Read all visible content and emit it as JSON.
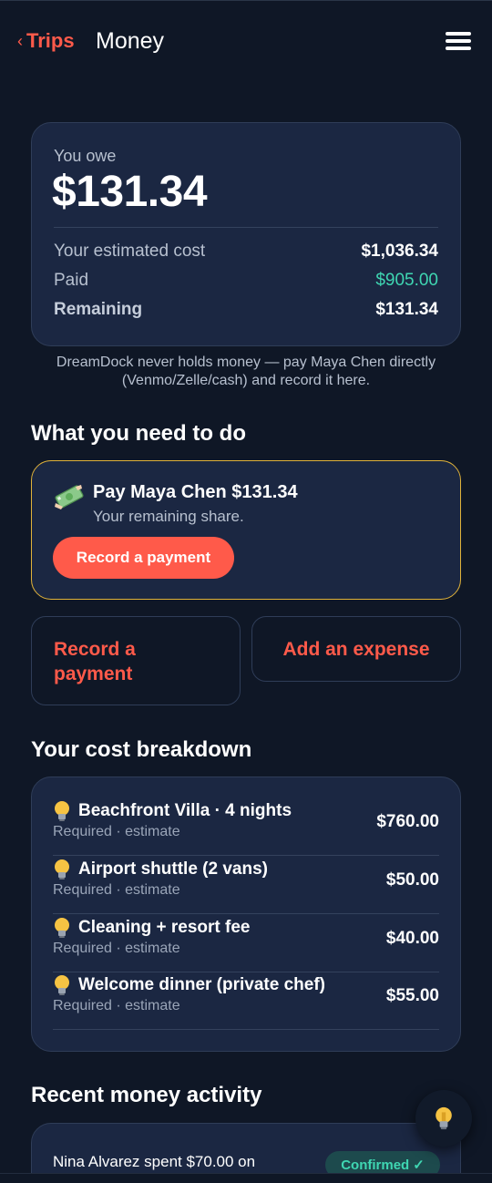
{
  "header": {
    "back_label": "Trips",
    "back_chevron": "‹",
    "title": "Money",
    "menu_icon": "hamburger-icon"
  },
  "owe_card": {
    "label": "You owe",
    "amount": "$131.34",
    "rows": [
      {
        "label": "Your estimated cost",
        "value": "$1,036.34"
      },
      {
        "label": "Paid",
        "value": "$905.00"
      },
      {
        "label": "Remaining",
        "value": "$131.34"
      }
    ]
  },
  "disclaimer": "DreamDock never holds money — pay Maya Chen directly (Venmo/Zelle/cash) and record it here.",
  "todo": {
    "section_title": "What you need to do",
    "title": "Pay Maya Chen $131.34",
    "subtitle": "Your remaining share.",
    "button_label": "Record a payment",
    "icon": "money-icon"
  },
  "actions": {
    "record_payment_label": "Record a payment",
    "add_expense_label": "Add an expense"
  },
  "breakdown": {
    "section_title": "Your cost breakdown",
    "items": [
      {
        "title": "Beachfront Villa · 4 nights",
        "subtitle": "Required · estimate",
        "amount": "$760.00"
      },
      {
        "title": "Airport shuttle (2 vans)",
        "subtitle": "Required · estimate",
        "amount": "$50.00"
      },
      {
        "title": "Cleaning + resort fee",
        "subtitle": "Required · estimate",
        "amount": "$40.00"
      },
      {
        "title": "Welcome dinner (private chef)",
        "subtitle": "Required · estimate",
        "amount": "$55.00"
      }
    ]
  },
  "activity": {
    "section_title": "Recent money activity",
    "items": [
      {
        "text": "Nina Alvarez spent $70.00 on",
        "status": "Confirmed",
        "status_mark": "✓"
      }
    ]
  },
  "colors": {
    "background": "#0f1726",
    "card": "#1b2742",
    "accent": "#ff5a4a",
    "success": "#3fd6b2",
    "highlight_border": "#e0b23a"
  },
  "fab": {
    "icon": "lightbulb-icon"
  }
}
